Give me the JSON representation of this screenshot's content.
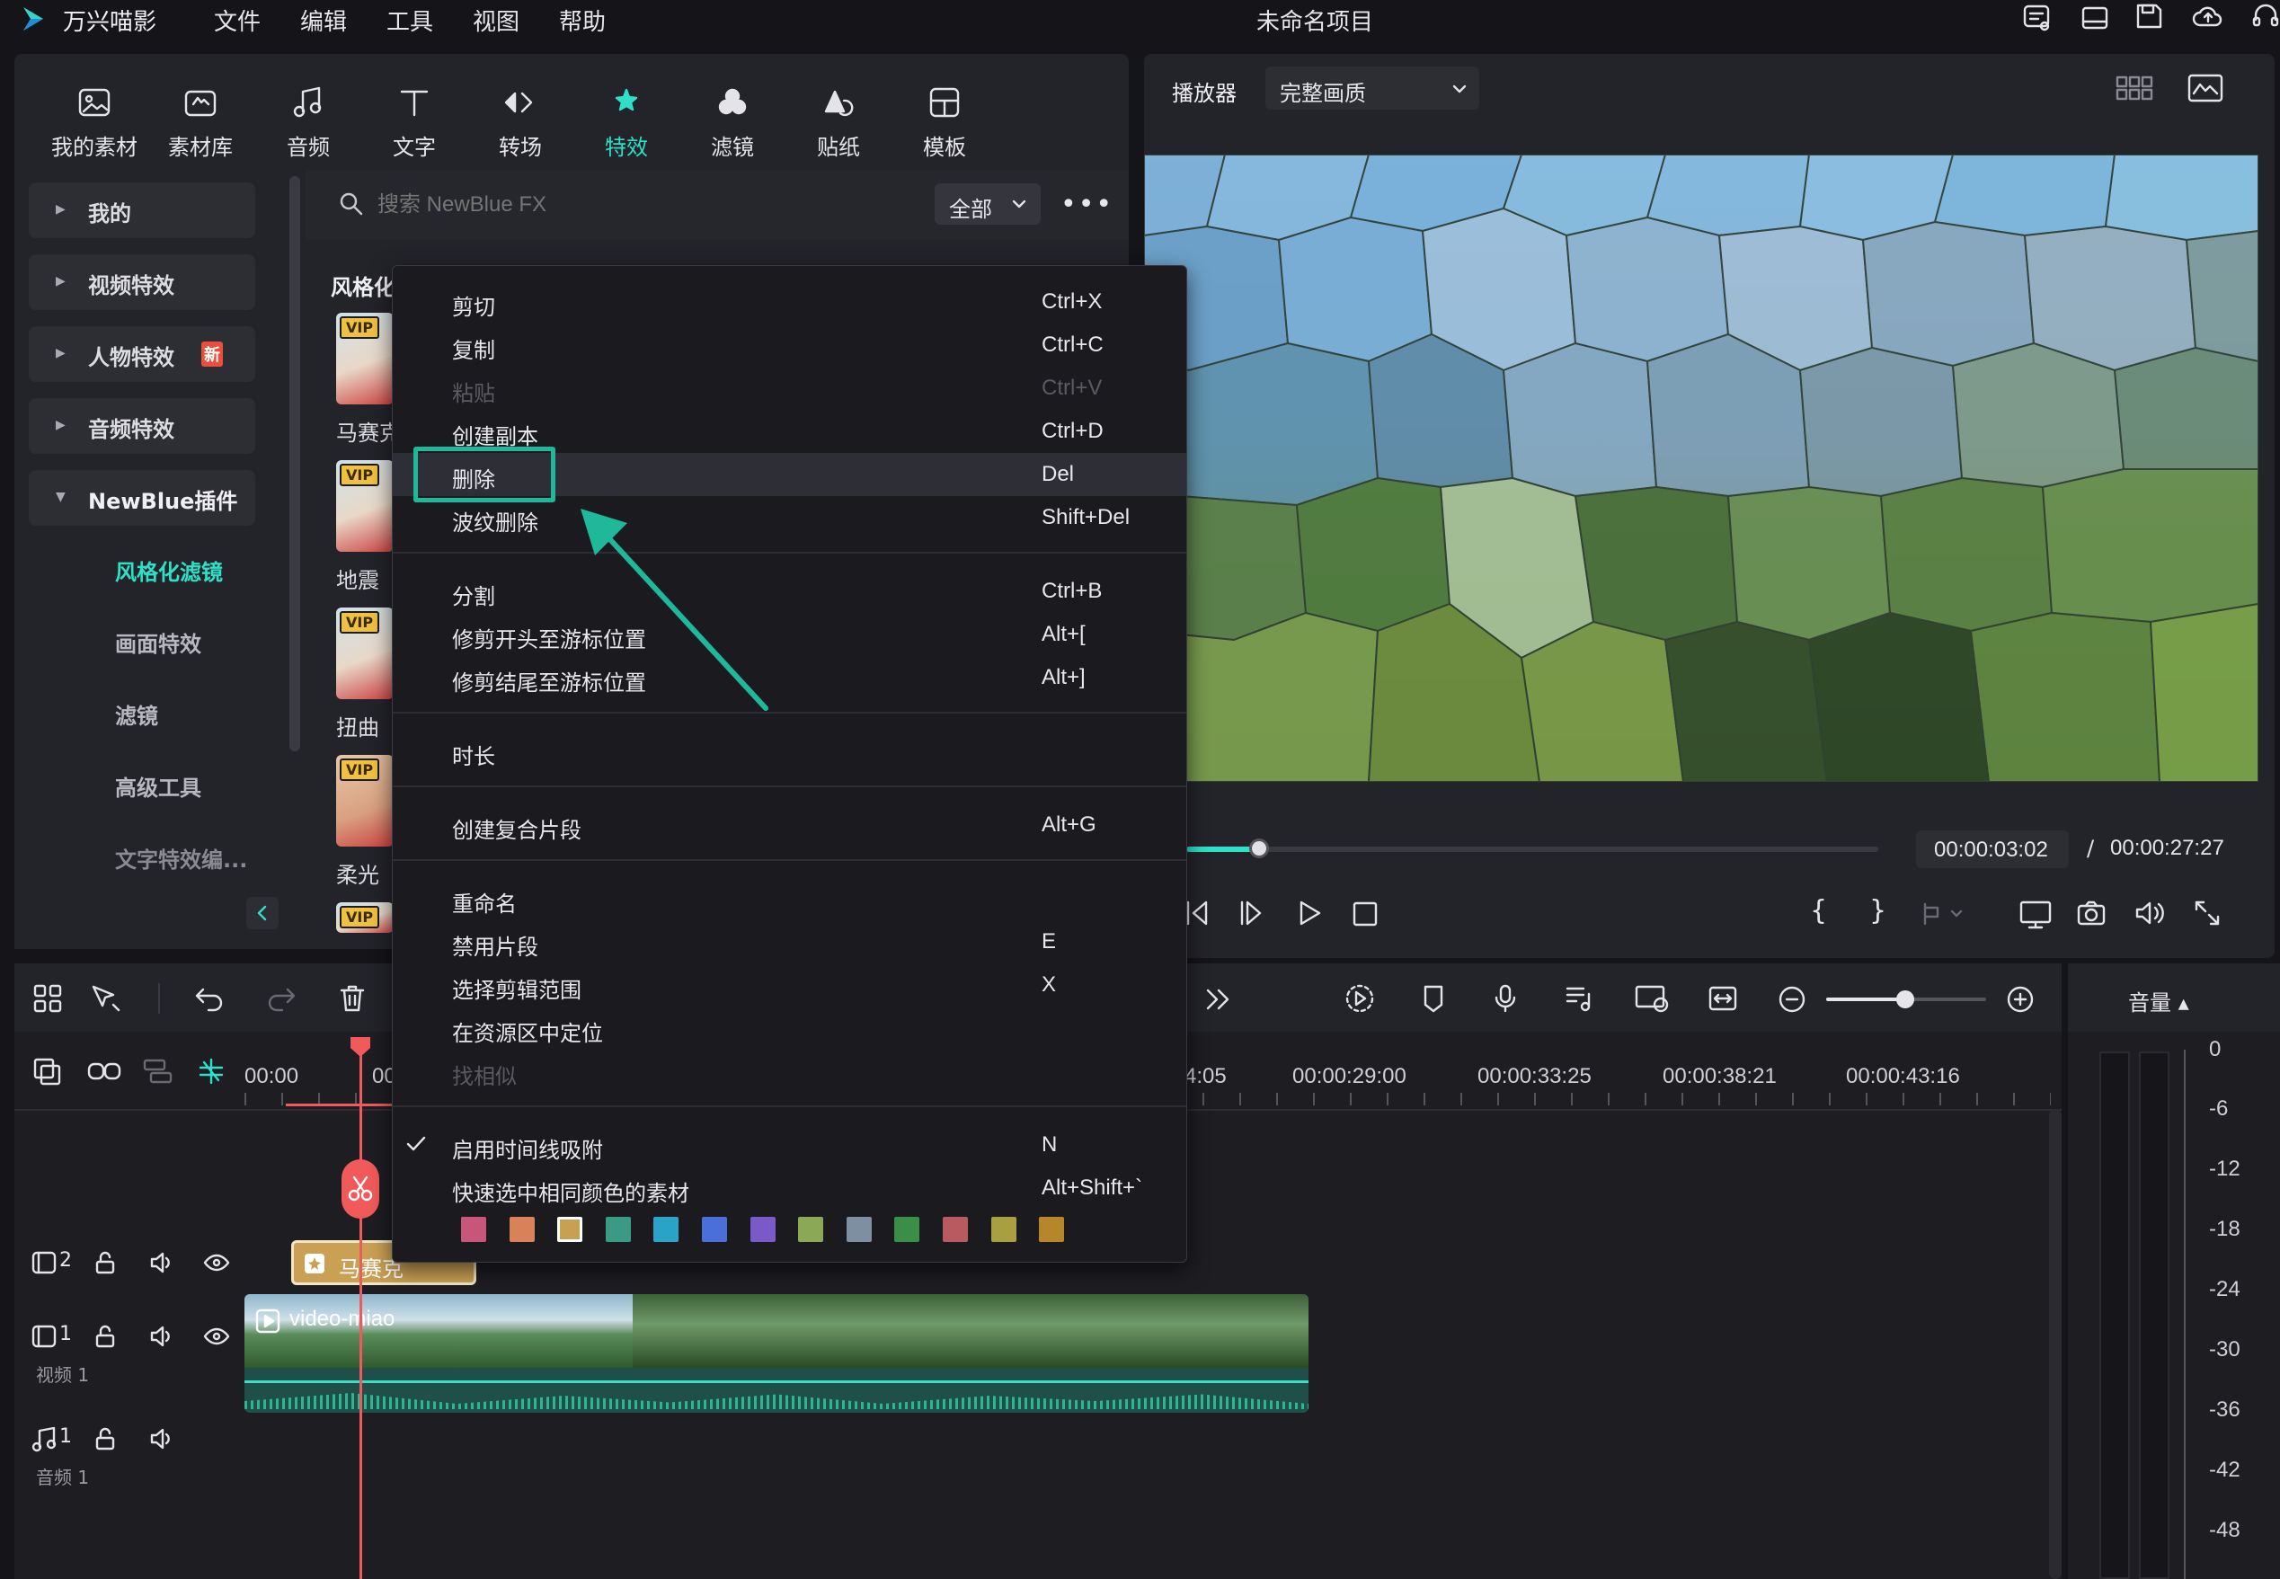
{
  "app": {
    "name": "万兴喵影",
    "title": "未命名项目"
  },
  "menubar": [
    "文件",
    "编辑",
    "工具",
    "视图",
    "帮助"
  ],
  "toptabs": [
    "我的素材",
    "素材库",
    "音频",
    "文字",
    "转场",
    "特效",
    "滤镜",
    "贴纸",
    "模板"
  ],
  "categories": {
    "mine": "我的",
    "video_fx": "视频特效",
    "people_fx": "人物特效",
    "new_badge": "新",
    "audio_fx": "音频特效",
    "newblue": "NewBlue插件"
  },
  "subcats": [
    "风格化滤镜",
    "画面特效",
    "滤镜",
    "高级工具",
    "文字特效编..."
  ],
  "search": {
    "placeholder": "搜索 NewBlue FX",
    "filter": "全部"
  },
  "section_title": "风格化",
  "thumbs": [
    "马赛克",
    "地震",
    "扭曲",
    "柔光"
  ],
  "vip": "VIP",
  "player": {
    "label": "播放器",
    "quality": "完整画质",
    "current": "00:00:03:02",
    "sep": "/",
    "total": "00:00:27:27"
  },
  "context_menu": [
    {
      "label": "剪切",
      "key": "Ctrl+X"
    },
    {
      "label": "复制",
      "key": "Ctrl+C"
    },
    {
      "label": "粘贴",
      "key": "Ctrl+V"
    },
    {
      "label": "创建副本",
      "key": "Ctrl+D"
    },
    {
      "label": "删除",
      "key": "Del"
    },
    {
      "label": "波纹删除",
      "key": "Shift+Del"
    },
    {
      "label": "分割",
      "key": "Ctrl+B"
    },
    {
      "label": "修剪开头至游标位置",
      "key": "Alt+["
    },
    {
      "label": "修剪结尾至游标位置",
      "key": "Alt+]"
    },
    {
      "label": "时长",
      "key": ""
    },
    {
      "label": "创建复合片段",
      "key": "Alt+G"
    },
    {
      "label": "重命名",
      "key": ""
    },
    {
      "label": "禁用片段",
      "key": "E"
    },
    {
      "label": "选择剪辑范围",
      "key": "X"
    },
    {
      "label": "在资源区中定位",
      "key": ""
    },
    {
      "label": "找相似",
      "key": ""
    },
    {
      "label": "启用时间线吸附",
      "key": "N"
    },
    {
      "label": "快速选中相同颜色的素材",
      "key": "Alt+Shift+`"
    }
  ],
  "swatch_colors": [
    "#c8567a",
    "#d9825a",
    "#c8a050",
    "#3a9a86",
    "#2aa3c8",
    "#4a6fd8",
    "#7a5ac8",
    "#8aa855",
    "#7d8fa0",
    "#3a8f48",
    "#b85a60",
    "#a8a040",
    "#b8862a"
  ],
  "timeline": {
    "ticks": [
      "00:00",
      "00",
      "4:05",
      "00:00:29:00",
      "00:00:33:25",
      "00:00:38:21",
      "00:00:43:16"
    ],
    "effect_clip": "马赛克",
    "video_clip": "video-miao",
    "track_video": "视频 1",
    "track_audio": "音频 1",
    "track2_num": "2",
    "track1_num": "1",
    "audio_num": "1"
  },
  "meter": {
    "label": "音量",
    "scale": [
      "0",
      "-6",
      "-12",
      "-18",
      "-24",
      "-30",
      "-36",
      "-42",
      "-48"
    ]
  },
  "colors": {
    "accent": "#2ee0c8",
    "playhead": "#f05a5a",
    "highlight_box": "#1fb89a"
  }
}
